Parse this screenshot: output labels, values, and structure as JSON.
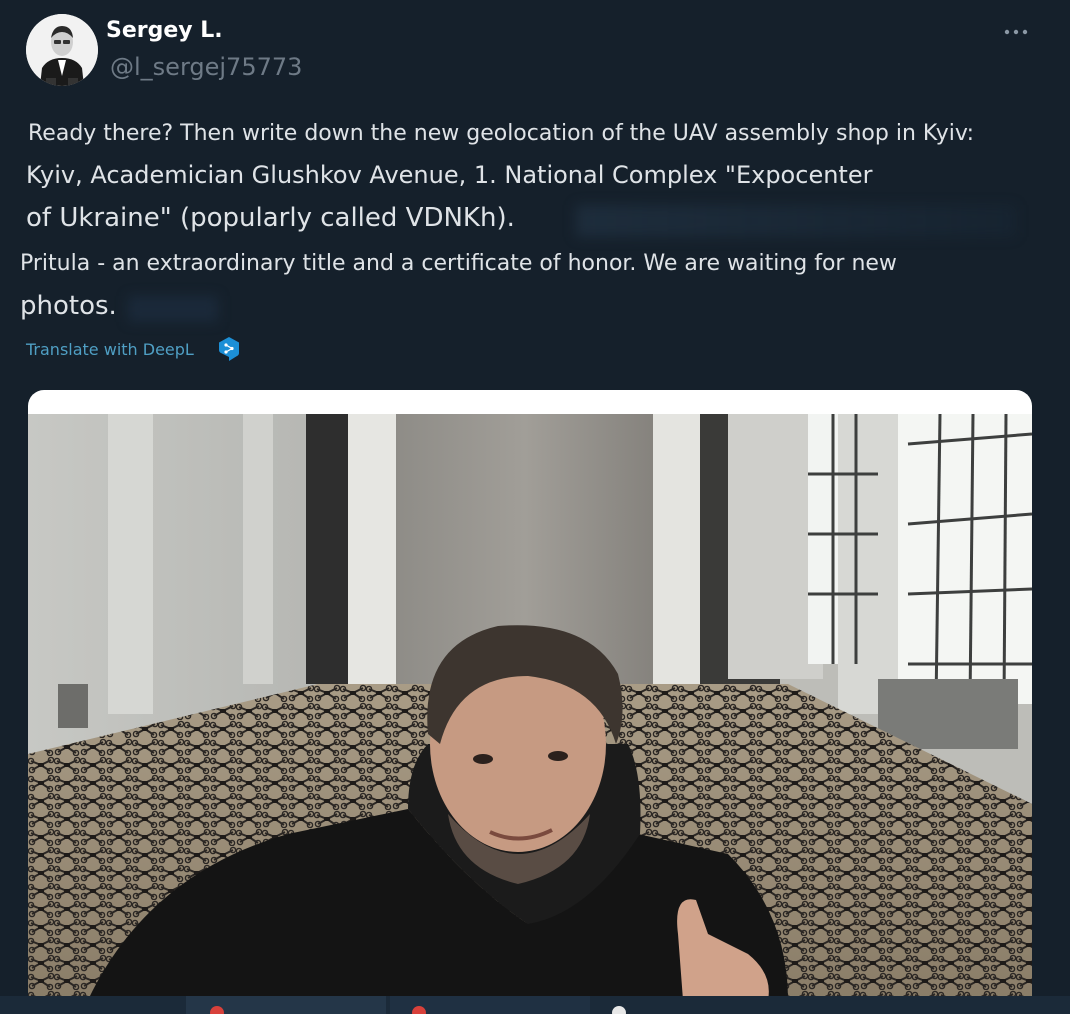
{
  "header": {
    "display_name": "Sergey L.",
    "handle": "@l_sergej75773"
  },
  "tweet": {
    "lines": [
      "Ready there? Then write down the new geolocation of the UAV assembly shop in Kyiv:",
      "Kyiv, Academician Glushkov Avenue, 1. National Complex \"Expocenter",
      "of Ukraine\" (popularly called VDNKh).",
      "Pritula - an extraordinary title and a certificate of honor. We are waiting for new",
      "photos."
    ],
    "translate_label": "Translate with DeepL"
  },
  "colors": {
    "background": "#15202b",
    "text": "#dfe3e7",
    "handle": "#6e7a86",
    "link": "#4f9fc4",
    "deepl": "#1c8fd6"
  },
  "icons": {
    "more": "more-horizontal-icon",
    "deepl": "deepl-icon"
  }
}
